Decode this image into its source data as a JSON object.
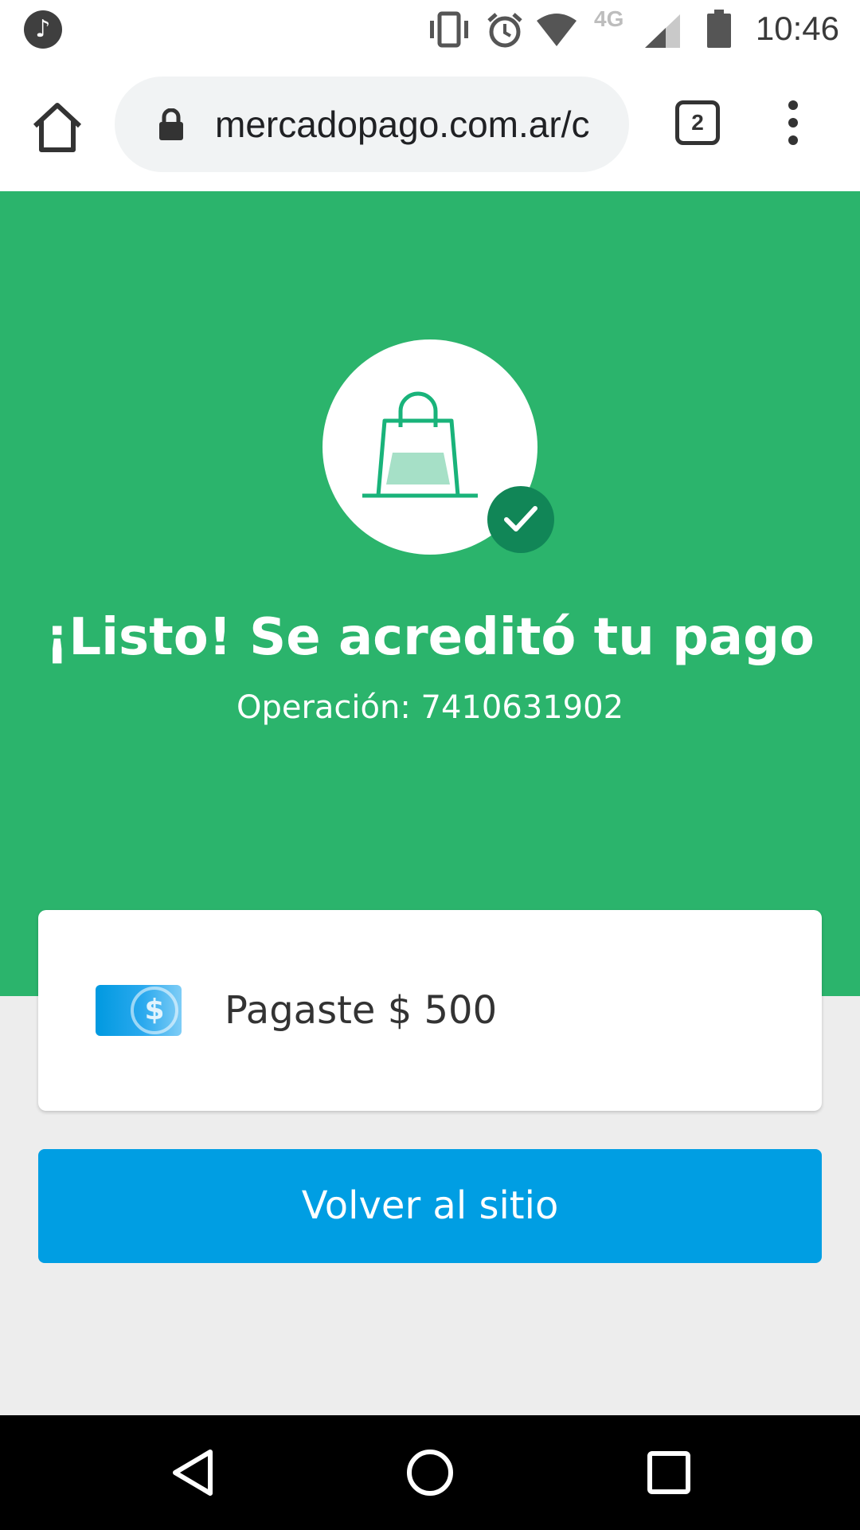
{
  "status_bar": {
    "time": "10:46",
    "network": "4G",
    "icons": [
      "music-note-icon",
      "vibrate-icon",
      "alarm-icon",
      "wifi-icon",
      "cell-signal-icon",
      "battery-icon"
    ]
  },
  "browser": {
    "url": "mercadopago.com.ar/c",
    "tab_count": "2"
  },
  "hero": {
    "title": "¡Listo! Se acreditó tu pago",
    "operation": "Operación: 7410631902",
    "background_color": "#2bb46c"
  },
  "payment": {
    "text": "Pagaste $ 500"
  },
  "actions": {
    "back_label": "Volver al sitio",
    "accent_color": "#009ee3"
  }
}
